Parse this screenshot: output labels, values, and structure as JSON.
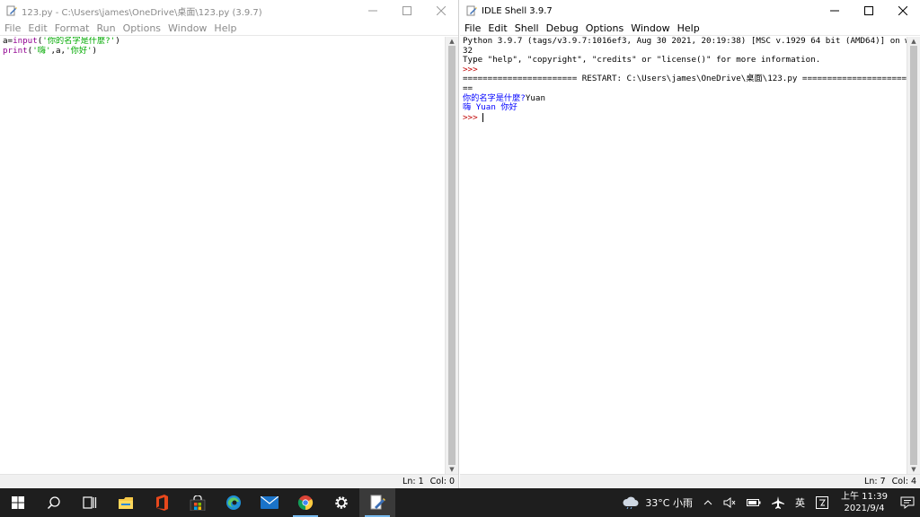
{
  "editor": {
    "title": "123.py - C:\\Users\\james\\OneDrive\\桌面\\123.py (3.9.7)",
    "menu": [
      "File",
      "Edit",
      "Format",
      "Run",
      "Options",
      "Window",
      "Help"
    ],
    "code": {
      "line1": {
        "var": "a=",
        "func": "input",
        "open": "(",
        "str": "'你的名字是什麼?'",
        "close": ")"
      },
      "line2": {
        "func": "print",
        "open": "(",
        "str1": "'嗨'",
        "mid": ",a,",
        "str2": "'你好'",
        "close": ")"
      }
    },
    "status": {
      "ln": "Ln: 1",
      "col": "Col: 0"
    }
  },
  "shell": {
    "title": "IDLE Shell 3.9.7",
    "menu": [
      "File",
      "Edit",
      "Shell",
      "Debug",
      "Options",
      "Window",
      "Help"
    ],
    "lines": {
      "banner1": "Python 3.9.7 (tags/v3.9.7:1016ef3, Aug 30 2021, 20:19:38) [MSC v.1929 64 bit (AMD64)] on win",
      "banner2": "32",
      "banner3": "Type \"help\", \"copyright\", \"credits\" or \"license()\" for more information.",
      "prompt1": ">>> ",
      "restart1": "======================= RESTART: C:\\Users\\james\\OneDrive\\桌面\\123.py ======================",
      "restart2": "==",
      "out1_prompt": "你的名字是什麼?",
      "out1_input": "Yuan",
      "out2": "嗨 Yuan 你好",
      "prompt2": ">>> "
    },
    "status": {
      "ln": "Ln: 7",
      "col": "Col: 4"
    }
  },
  "taskbar": {
    "apps": [
      "start-icon",
      "search-icon",
      "task-view-icon",
      "file-explorer-icon",
      "office-icon",
      "store-icon",
      "edge-icon",
      "mail-icon",
      "chrome-icon",
      "settings-icon",
      "idle-icon"
    ],
    "weather": "33°C  小雨",
    "ime": "英",
    "time": "上午 11:39",
    "date": "2021/9/4"
  },
  "colors": {
    "builtin": "#900090",
    "string": "#00aa00",
    "stdout": "#0000ff",
    "prompt": "#c00000",
    "taskbar": "#1e1e1e"
  }
}
